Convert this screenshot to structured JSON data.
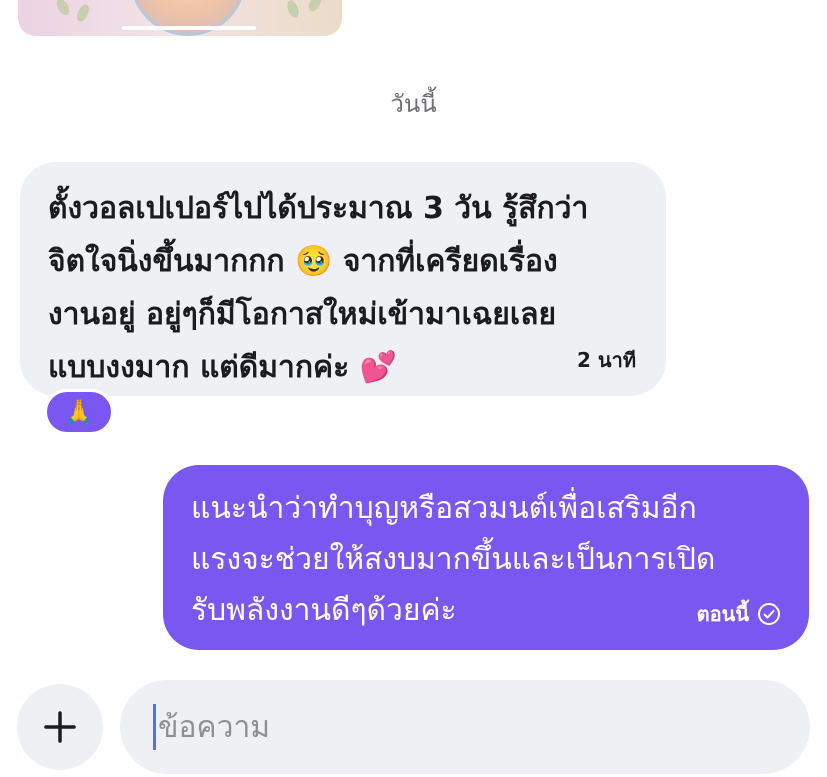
{
  "date_divider": "วันนี้",
  "incoming_message": {
    "text": "ตั้งวอลเปเปอร์ไปได้ประมาณ 3 วัน รู้สึกว่า\nจิตใจนิ่งขึ้นมากกก 🥹 จากที่เครียดเรื่อง\nงานอยู่ อยู่ๆก็มีโอกาสใหม่เข้ามาเฉยเลย\nแบบงงมาก แต่ดีมากค่ะ 💕",
    "time": "2 นาที",
    "reaction": "🙏"
  },
  "outgoing_message": {
    "text": "แนะนำว่าทำบุญหรือสวมนต์เพื่อเสริมอีก\nแรงจะช่วยให้สงบมากขึ้นและเป็นการเปิด\nรับพลังงานดีๆด้วยค่ะ",
    "time": "ตอนนี้",
    "status_icon": "check-circle-icon"
  },
  "composer": {
    "placeholder": "ข้อความ",
    "add_icon": "plus-icon"
  },
  "colors": {
    "accent": "#7b57f2",
    "incoming_bubble": "#eef0f3",
    "caret": "#5b6cf0"
  }
}
